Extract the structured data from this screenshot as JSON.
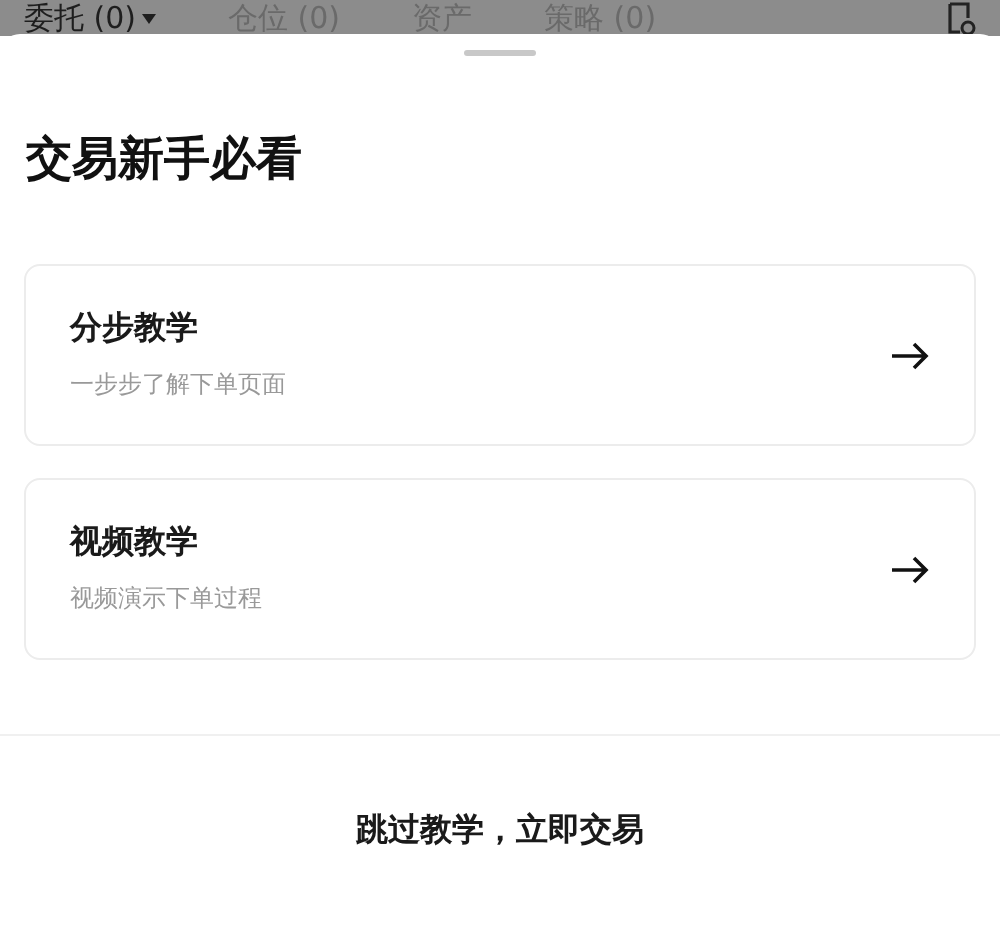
{
  "background_tabs": [
    {
      "label": "委托 (0)",
      "selected": true,
      "has_caret": true
    },
    {
      "label": "仓位 (0)",
      "selected": false,
      "has_caret": false
    },
    {
      "label": "资产",
      "selected": false,
      "has_caret": false
    },
    {
      "label": "策略 (0)",
      "selected": false,
      "has_caret": false
    }
  ],
  "sheet": {
    "title": "交易新手必看",
    "options": [
      {
        "title": "分步教学",
        "subtitle": "一步步了解下单页面"
      },
      {
        "title": "视频教学",
        "subtitle": "视频演示下单过程"
      }
    ],
    "skip_button": "跳过教学，立即交易"
  }
}
